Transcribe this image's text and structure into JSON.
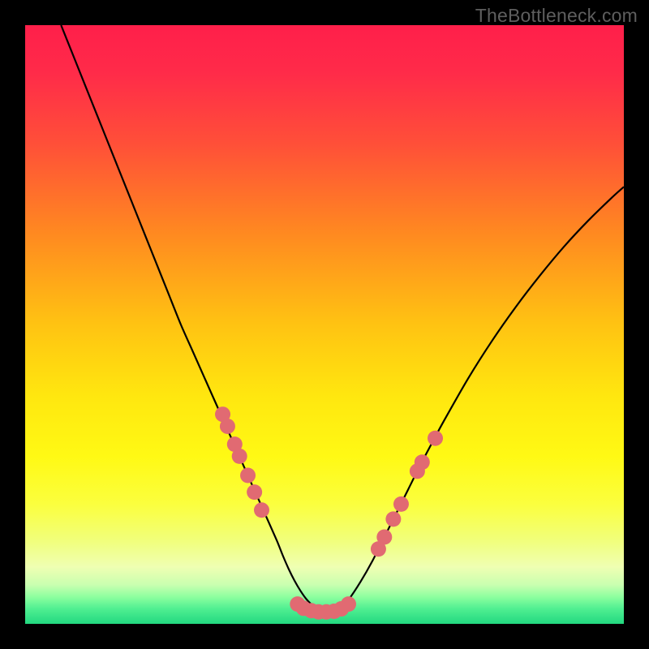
{
  "watermark": {
    "text": "TheBottleneck.com"
  },
  "colors": {
    "frame": "#000000",
    "curve": "#000000",
    "marker_fill": "#e16a72",
    "marker_stroke": "#c94f58",
    "gradient_stops": [
      {
        "offset": 0.0,
        "color": "#ff1f4a"
      },
      {
        "offset": 0.08,
        "color": "#ff2b49"
      },
      {
        "offset": 0.2,
        "color": "#ff5038"
      },
      {
        "offset": 0.35,
        "color": "#ff8a20"
      },
      {
        "offset": 0.5,
        "color": "#ffc312"
      },
      {
        "offset": 0.62,
        "color": "#ffe70f"
      },
      {
        "offset": 0.72,
        "color": "#fff914"
      },
      {
        "offset": 0.8,
        "color": "#fbff3e"
      },
      {
        "offset": 0.86,
        "color": "#f1ff7a"
      },
      {
        "offset": 0.905,
        "color": "#efffb2"
      },
      {
        "offset": 0.935,
        "color": "#c9ffb0"
      },
      {
        "offset": 0.955,
        "color": "#8dff9f"
      },
      {
        "offset": 0.975,
        "color": "#4fef91"
      },
      {
        "offset": 1.0,
        "color": "#22d880"
      }
    ]
  },
  "chart_data": {
    "type": "line",
    "title": "",
    "xlabel": "",
    "ylabel": "",
    "xlim": [
      0,
      100
    ],
    "ylim": [
      0,
      100
    ],
    "grid": false,
    "legend": false,
    "series": [
      {
        "name": "bottleneck-curve",
        "x": [
          6,
          8,
          10,
          12,
          14,
          16,
          18,
          20,
          22,
          24,
          26,
          28,
          30,
          32,
          34,
          36,
          38,
          40,
          42,
          43,
          44,
          45,
          46,
          47,
          48,
          49,
          50,
          51,
          52,
          53,
          54,
          56,
          58,
          60,
          62,
          64,
          66,
          68,
          70,
          74,
          78,
          82,
          86,
          90,
          94,
          98,
          100
        ],
        "y": [
          100,
          95,
          90,
          85,
          80,
          75,
          70,
          65,
          60,
          55,
          50,
          45.5,
          41,
          36.5,
          32,
          27.5,
          23,
          18.5,
          14,
          11.5,
          9.2,
          7.2,
          5.5,
          4.1,
          3.1,
          2.4,
          2.0,
          2.0,
          2.3,
          3.0,
          4.0,
          7.0,
          10.5,
          14.5,
          18.5,
          22.5,
          26.5,
          30.3,
          34.0,
          41.0,
          47.3,
          53.0,
          58.2,
          63.0,
          67.3,
          71.2,
          73.0
        ]
      }
    ],
    "markers": {
      "name": "sample-points",
      "points": [
        {
          "x": 33.0,
          "y": 35.0
        },
        {
          "x": 33.8,
          "y": 33.0
        },
        {
          "x": 35.0,
          "y": 30.0
        },
        {
          "x": 35.8,
          "y": 28.0
        },
        {
          "x": 37.2,
          "y": 24.8
        },
        {
          "x": 38.3,
          "y": 22.0
        },
        {
          "x": 39.5,
          "y": 19.0
        },
        {
          "x": 45.5,
          "y": 3.3
        },
        {
          "x": 46.5,
          "y": 2.6
        },
        {
          "x": 47.8,
          "y": 2.2
        },
        {
          "x": 49.0,
          "y": 2.0
        },
        {
          "x": 50.3,
          "y": 2.0
        },
        {
          "x": 51.6,
          "y": 2.1
        },
        {
          "x": 52.8,
          "y": 2.5
        },
        {
          "x": 54.0,
          "y": 3.3
        },
        {
          "x": 59.0,
          "y": 12.5
        },
        {
          "x": 60.0,
          "y": 14.5
        },
        {
          "x": 61.5,
          "y": 17.5
        },
        {
          "x": 62.8,
          "y": 20.0
        },
        {
          "x": 65.5,
          "y": 25.5
        },
        {
          "x": 66.3,
          "y": 27.0
        },
        {
          "x": 68.5,
          "y": 31.0
        }
      ]
    }
  }
}
